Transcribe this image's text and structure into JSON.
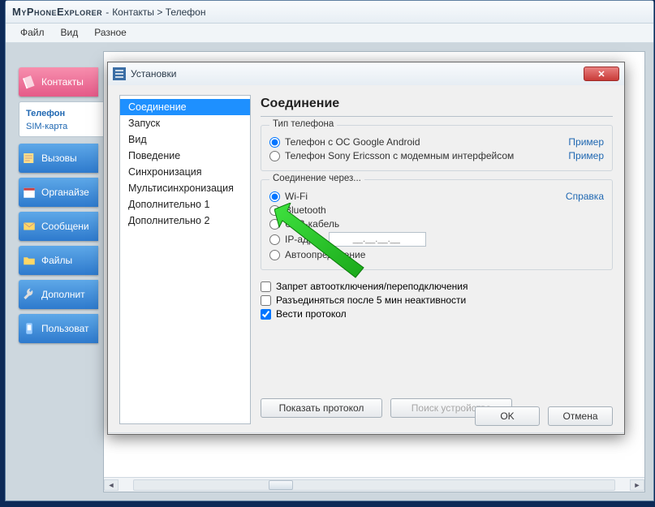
{
  "title": {
    "app": "MyPhoneExplorer",
    "breadcrumb": "Контакты > Телефон"
  },
  "menu": {
    "file": "Файл",
    "view": "Вид",
    "misc": "Разное"
  },
  "sidebar": {
    "items": [
      {
        "label": "Контакты"
      },
      {
        "label": "Вызовы"
      },
      {
        "label": "Органайзе"
      },
      {
        "label": "Сообщени"
      },
      {
        "label": "Файлы"
      },
      {
        "label": "Дополнит"
      },
      {
        "label": "Пользоват"
      }
    ],
    "subtabs": {
      "phone": "Телефон",
      "sim": "SIM-карта"
    }
  },
  "dialog": {
    "title": "Установки",
    "nav": [
      "Соединение",
      "Запуск",
      "Вид",
      "Поведение",
      "Синхронизация",
      "Мультисинхронизация",
      "Дополнительно 1",
      "Дополнительно 2"
    ],
    "panel": {
      "heading": "Соединение",
      "phone_type": {
        "legend": "Тип телефона",
        "opt_android": "Телефон с ОС Google Android",
        "opt_sony": "Телефон Sony Ericsson с модемным интерфейсом",
        "link": "Пример"
      },
      "connection": {
        "legend": "Соединение через...",
        "opt_wifi": "Wi-Fi",
        "opt_bt": "Bluetooth",
        "opt_usb": "USB-кабель",
        "opt_ip": "IP-адрес",
        "ip_placeholder": "__.__.__.__ ",
        "opt_auto": "Автоопределение",
        "link": "Справка"
      },
      "checks": {
        "c1": "Запрет автоотключения/переподключения",
        "c2": "Разъединяться после 5 мин неактивности",
        "c3": "Вести протокол"
      },
      "btn_show": "Показать протокол",
      "btn_search": "Поиск устройства"
    },
    "btn_ok": "OK",
    "btn_cancel": "Отмена"
  }
}
